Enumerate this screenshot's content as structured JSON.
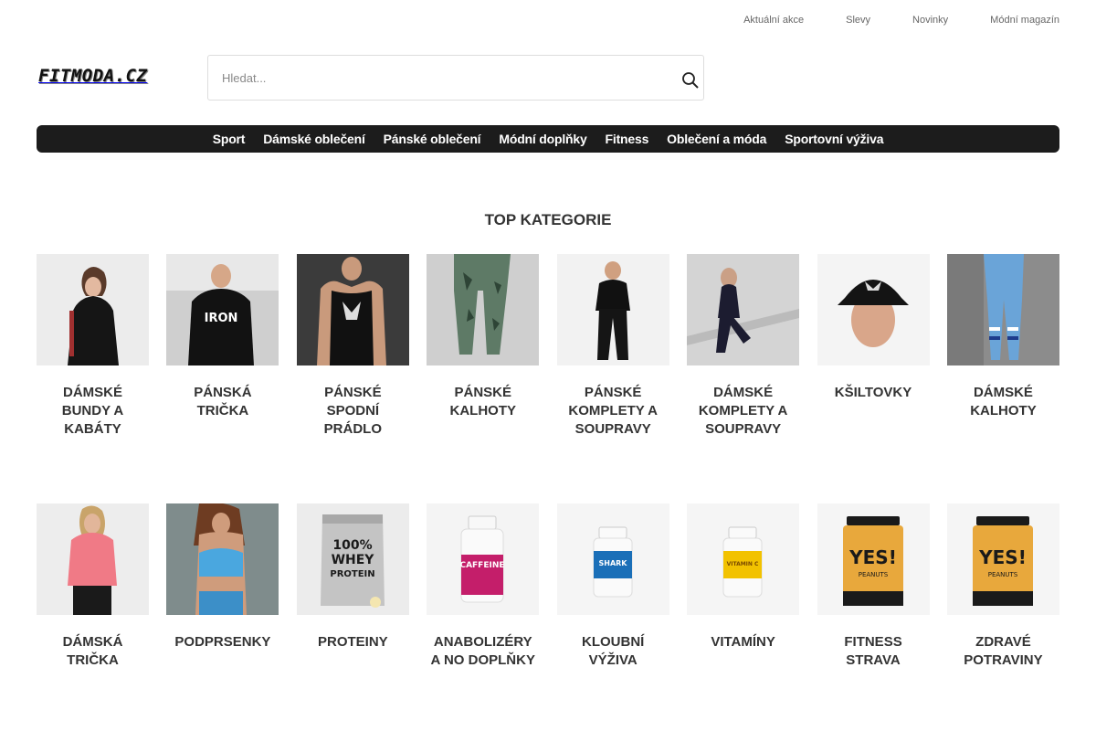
{
  "top_links": [
    "Aktuální akce",
    "Slevy",
    "Novinky",
    "Módní magazín"
  ],
  "logo_text": "FITMODA.CZ",
  "search": {
    "placeholder": "Hledat...",
    "icon": "search-icon"
  },
  "nav": [
    "Sport",
    "Dámské oblečení",
    "Pánské oblečení",
    "Módní doplňky",
    "Fitness",
    "Oblečení a móda",
    "Sportovní výživa"
  ],
  "section_title": "TOP KATEGORIE",
  "categories_row1": [
    {
      "label": "Dámské bundy a kabáty"
    },
    {
      "label": "Pánská trička"
    },
    {
      "label": "Pánské spodní prádlo"
    },
    {
      "label": "Pánské kalhoty"
    },
    {
      "label": "Pánské komplety a soupravy"
    },
    {
      "label": "Dámské komplety a soupravy"
    },
    {
      "label": "Kšiltovky"
    },
    {
      "label": "Dámské kalhoty"
    }
  ],
  "categories_row2": [
    {
      "label": "Dámská trička"
    },
    {
      "label": "Podprsenky"
    },
    {
      "label": "Proteiny"
    },
    {
      "label": "Anabolizéry a NO doplňky"
    },
    {
      "label": "Kloubní výživa"
    },
    {
      "label": "Vitamíny"
    },
    {
      "label": "Fitness strava"
    },
    {
      "label": "Zdravé potraviny"
    }
  ],
  "product_label_text": {
    "whey_line1": "100%",
    "whey_line2": "WHEY",
    "whey_line3": "PROTEIN",
    "caffeine": "CAFFEINE",
    "shark": "SHARK",
    "vitamin": "VITAMIN C",
    "yes": "YES!",
    "yes_sub": "PEANUTS"
  }
}
